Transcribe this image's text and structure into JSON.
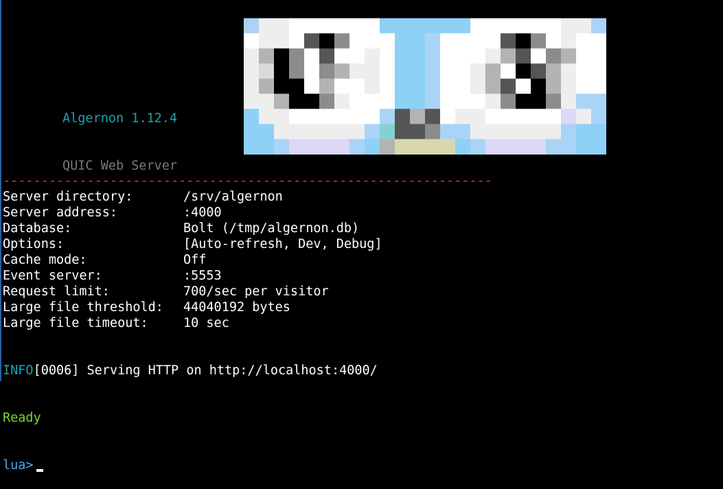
{
  "app": {
    "name": "Algernon 1.12.4",
    "subtitle": "QUIC Web Server"
  },
  "logo": {
    "icon": "pixel-art-owl-logo"
  },
  "separator": "----------------------------------------------------------------",
  "server_info": [
    {
      "label": "Server directory:",
      "value": "/srv/algernon"
    },
    {
      "label": "Server address:",
      "value": ":4000"
    },
    {
      "label": "Database:",
      "value": "Bolt (/tmp/algernon.db)"
    },
    {
      "label": "Options:",
      "value": "[Auto-refresh, Dev, Debug]"
    },
    {
      "label": "Cache mode:",
      "value": "Off"
    },
    {
      "label": "Event server:",
      "value": ":5553"
    },
    {
      "label": "Request limit:",
      "value": "700/sec per visitor"
    },
    {
      "label": "Large file threshold:",
      "value": "44040192 bytes"
    },
    {
      "label": "Large file timeout:",
      "value": "10 sec"
    }
  ],
  "log": {
    "level": "INFO",
    "message": "[0006] Serving HTTP on http://localhost:4000/",
    "status": "Ready",
    "prompt": "lua>"
  },
  "colors": {
    "background": "#000000",
    "accent_cyan": "#1fa3b0",
    "separator_red": "#e23636",
    "ready_green": "#7cd63a",
    "prompt_blue": "#4aa8f0"
  }
}
